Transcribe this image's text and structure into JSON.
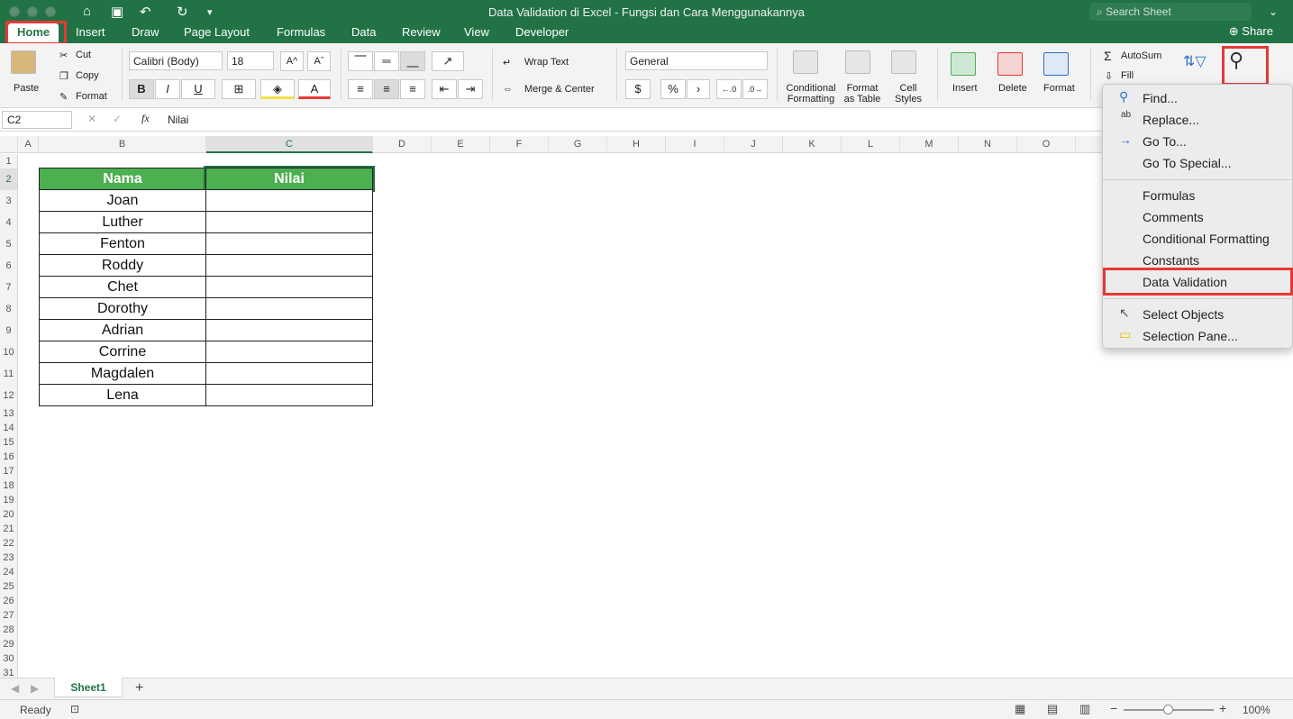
{
  "window": {
    "title": "Data Validation di Excel - Fungsi dan Cara Menggunakannya",
    "search_placeholder": "Search Sheet"
  },
  "tabs": [
    "Home",
    "Insert",
    "Draw",
    "Page Layout",
    "Formulas",
    "Data",
    "Review",
    "View",
    "Developer"
  ],
  "share_label": "Share",
  "ribbon": {
    "paste": "Paste",
    "cut": "Cut",
    "copy": "Copy",
    "format": "Format",
    "font_name": "Calibri (Body)",
    "font_size": "18",
    "bold": "B",
    "italic": "I",
    "underline": "U",
    "wrap_text": "Wrap Text",
    "merge_center": "Merge & Center",
    "number_format": "General",
    "currency": "$",
    "percent": "%",
    "cond_fmt": "Conditional Formatting",
    "format_table": "Format as Table",
    "cell_styles": "Cell Styles",
    "insert": "Insert",
    "delete": "Delete",
    "format_cells": "Format",
    "autosum": "AutoSum",
    "fill": "Fill"
  },
  "formula_bar": {
    "name_box": "C2",
    "fx": "fx",
    "value": "Nilai"
  },
  "columns": [
    "A",
    "B",
    "C",
    "D",
    "E",
    "F",
    "G",
    "H",
    "I",
    "J",
    "K",
    "L",
    "M",
    "N",
    "O"
  ],
  "rows": [
    "1",
    "2",
    "3",
    "4",
    "5",
    "6",
    "7",
    "8",
    "9",
    "10",
    "11",
    "12",
    "13",
    "14",
    "15",
    "16",
    "17",
    "18",
    "19",
    "20",
    "21",
    "22",
    "23",
    "24",
    "25",
    "26",
    "27",
    "28",
    "29",
    "30",
    "31"
  ],
  "table": {
    "header_nama": "Nama",
    "header_nilai": "Nilai",
    "names": [
      "Joan",
      "Luther",
      "Fenton",
      "Roddy",
      "Chet",
      "Dorothy",
      "Adrian",
      "Corrine",
      "Magdalen",
      "Lena"
    ]
  },
  "find_menu": {
    "items": [
      "Find...",
      "Replace...",
      "Go To...",
      "Go To Special...",
      "Formulas",
      "Comments",
      "Conditional Formatting",
      "Constants",
      "Data Validation",
      "Select Objects",
      "Selection Pane..."
    ]
  },
  "sheet_tab": "Sheet1",
  "status": {
    "ready": "Ready",
    "zoom": "100%"
  },
  "colors": {
    "excel_green": "#217346",
    "header_fill": "#4caf50",
    "highlight": "#e53935"
  }
}
